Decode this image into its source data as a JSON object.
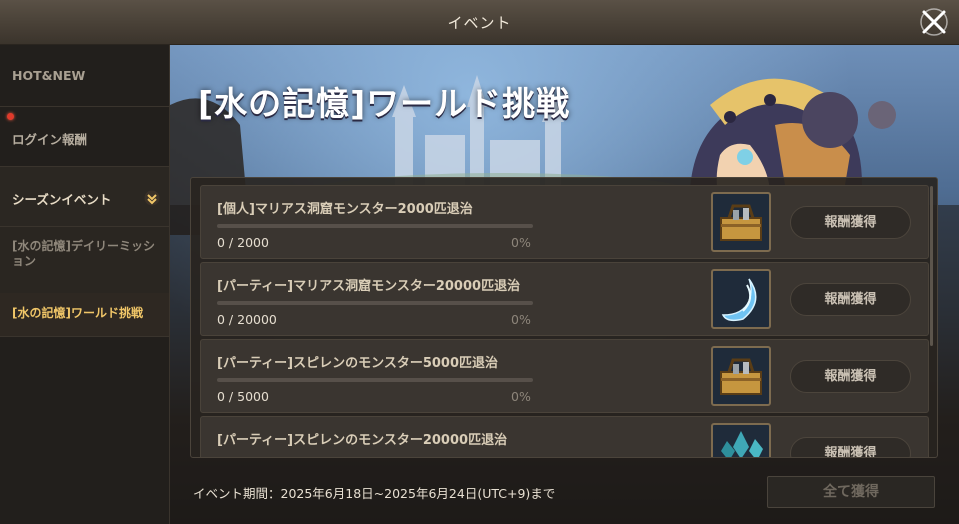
{
  "window": {
    "title": "イベント",
    "close_icon": "close-x-icon"
  },
  "sidebar": {
    "hot_new": "HOT&NEW",
    "login_reward": "ログイン報酬",
    "season_event": "シーズンイベント",
    "sub_daily": "[水の記憶]デイリーミッション",
    "sub_world": "[水の記憶]ワールド挑戦"
  },
  "banner": {
    "title": "[水の記憶]ワールド挑戦"
  },
  "missions": [
    {
      "name": "[個人]マリアス洞窟モンスター2000匹退治",
      "progress": "0 / 2000",
      "percent": "0%",
      "fill": 0,
      "reward_icon": "treasure-toolbox-icon",
      "button": "報酬獲得"
    },
    {
      "name": "[パーティー]マリアス洞窟モンスター20000匹退治",
      "progress": "0 / 20000",
      "percent": "0%",
      "fill": 0,
      "reward_icon": "crescent-crystal-icon",
      "button": "報酬獲得"
    },
    {
      "name": "[パーティー]スピレンのモンスター5000匹退治",
      "progress": "0 / 5000",
      "percent": "0%",
      "fill": 0,
      "reward_icon": "treasure-toolbox-icon",
      "button": "報酬獲得"
    },
    {
      "name": "[パーティー]スピレンのモンスター20000匹退治",
      "progress": "",
      "percent": "",
      "fill": 0,
      "reward_icon": "crystal-cluster-icon",
      "button": "報酬獲得"
    }
  ],
  "footer": {
    "period": "イベント期間：2025年6月18日~2025年6月24日(UTC+9)まで",
    "claim_all": "全て獲得"
  },
  "colors": {
    "accent_gold": "#f0c668",
    "badge_red": "#e03a2b"
  }
}
